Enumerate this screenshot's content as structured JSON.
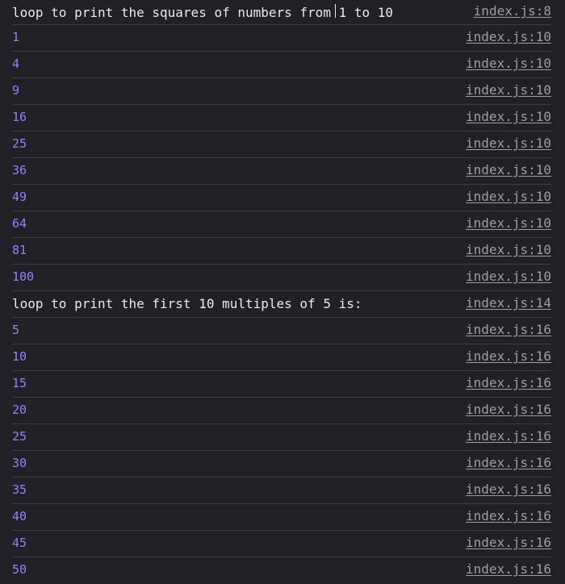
{
  "console": {
    "colors": {
      "background": "#202124",
      "text": "#e8eaed",
      "number": "#9980ff",
      "link": "#9aa0a6",
      "divider": "#3c4043"
    },
    "rows": [
      {
        "type": "text",
        "message": "loop to print the squares of numbers from 1 to 10",
        "source": "index.js:8"
      },
      {
        "type": "num",
        "message": "1",
        "source": "index.js:10"
      },
      {
        "type": "num",
        "message": "4",
        "source": "index.js:10"
      },
      {
        "type": "num",
        "message": "9",
        "source": "index.js:10"
      },
      {
        "type": "num",
        "message": "16",
        "source": "index.js:10"
      },
      {
        "type": "num",
        "message": "25",
        "source": "index.js:10"
      },
      {
        "type": "num",
        "message": "36",
        "source": "index.js:10"
      },
      {
        "type": "num",
        "message": "49",
        "source": "index.js:10"
      },
      {
        "type": "num",
        "message": "64",
        "source": "index.js:10"
      },
      {
        "type": "num",
        "message": "81",
        "source": "index.js:10"
      },
      {
        "type": "num",
        "message": "100",
        "source": "index.js:10"
      },
      {
        "type": "text",
        "message": "loop to print the first 10 multiples of 5 is:",
        "source": "index.js:14"
      },
      {
        "type": "num",
        "message": "5",
        "source": "index.js:16"
      },
      {
        "type": "num",
        "message": "10",
        "source": "index.js:16"
      },
      {
        "type": "num",
        "message": "15",
        "source": "index.js:16"
      },
      {
        "type": "num",
        "message": "20",
        "source": "index.js:16"
      },
      {
        "type": "num",
        "message": "25",
        "source": "index.js:16"
      },
      {
        "type": "num",
        "message": "30",
        "source": "index.js:16"
      },
      {
        "type": "num",
        "message": "35",
        "source": "index.js:16"
      },
      {
        "type": "num",
        "message": "40",
        "source": "index.js:16"
      },
      {
        "type": "num",
        "message": "45",
        "source": "index.js:16"
      },
      {
        "type": "num",
        "message": "50",
        "source": "index.js:16"
      }
    ]
  }
}
